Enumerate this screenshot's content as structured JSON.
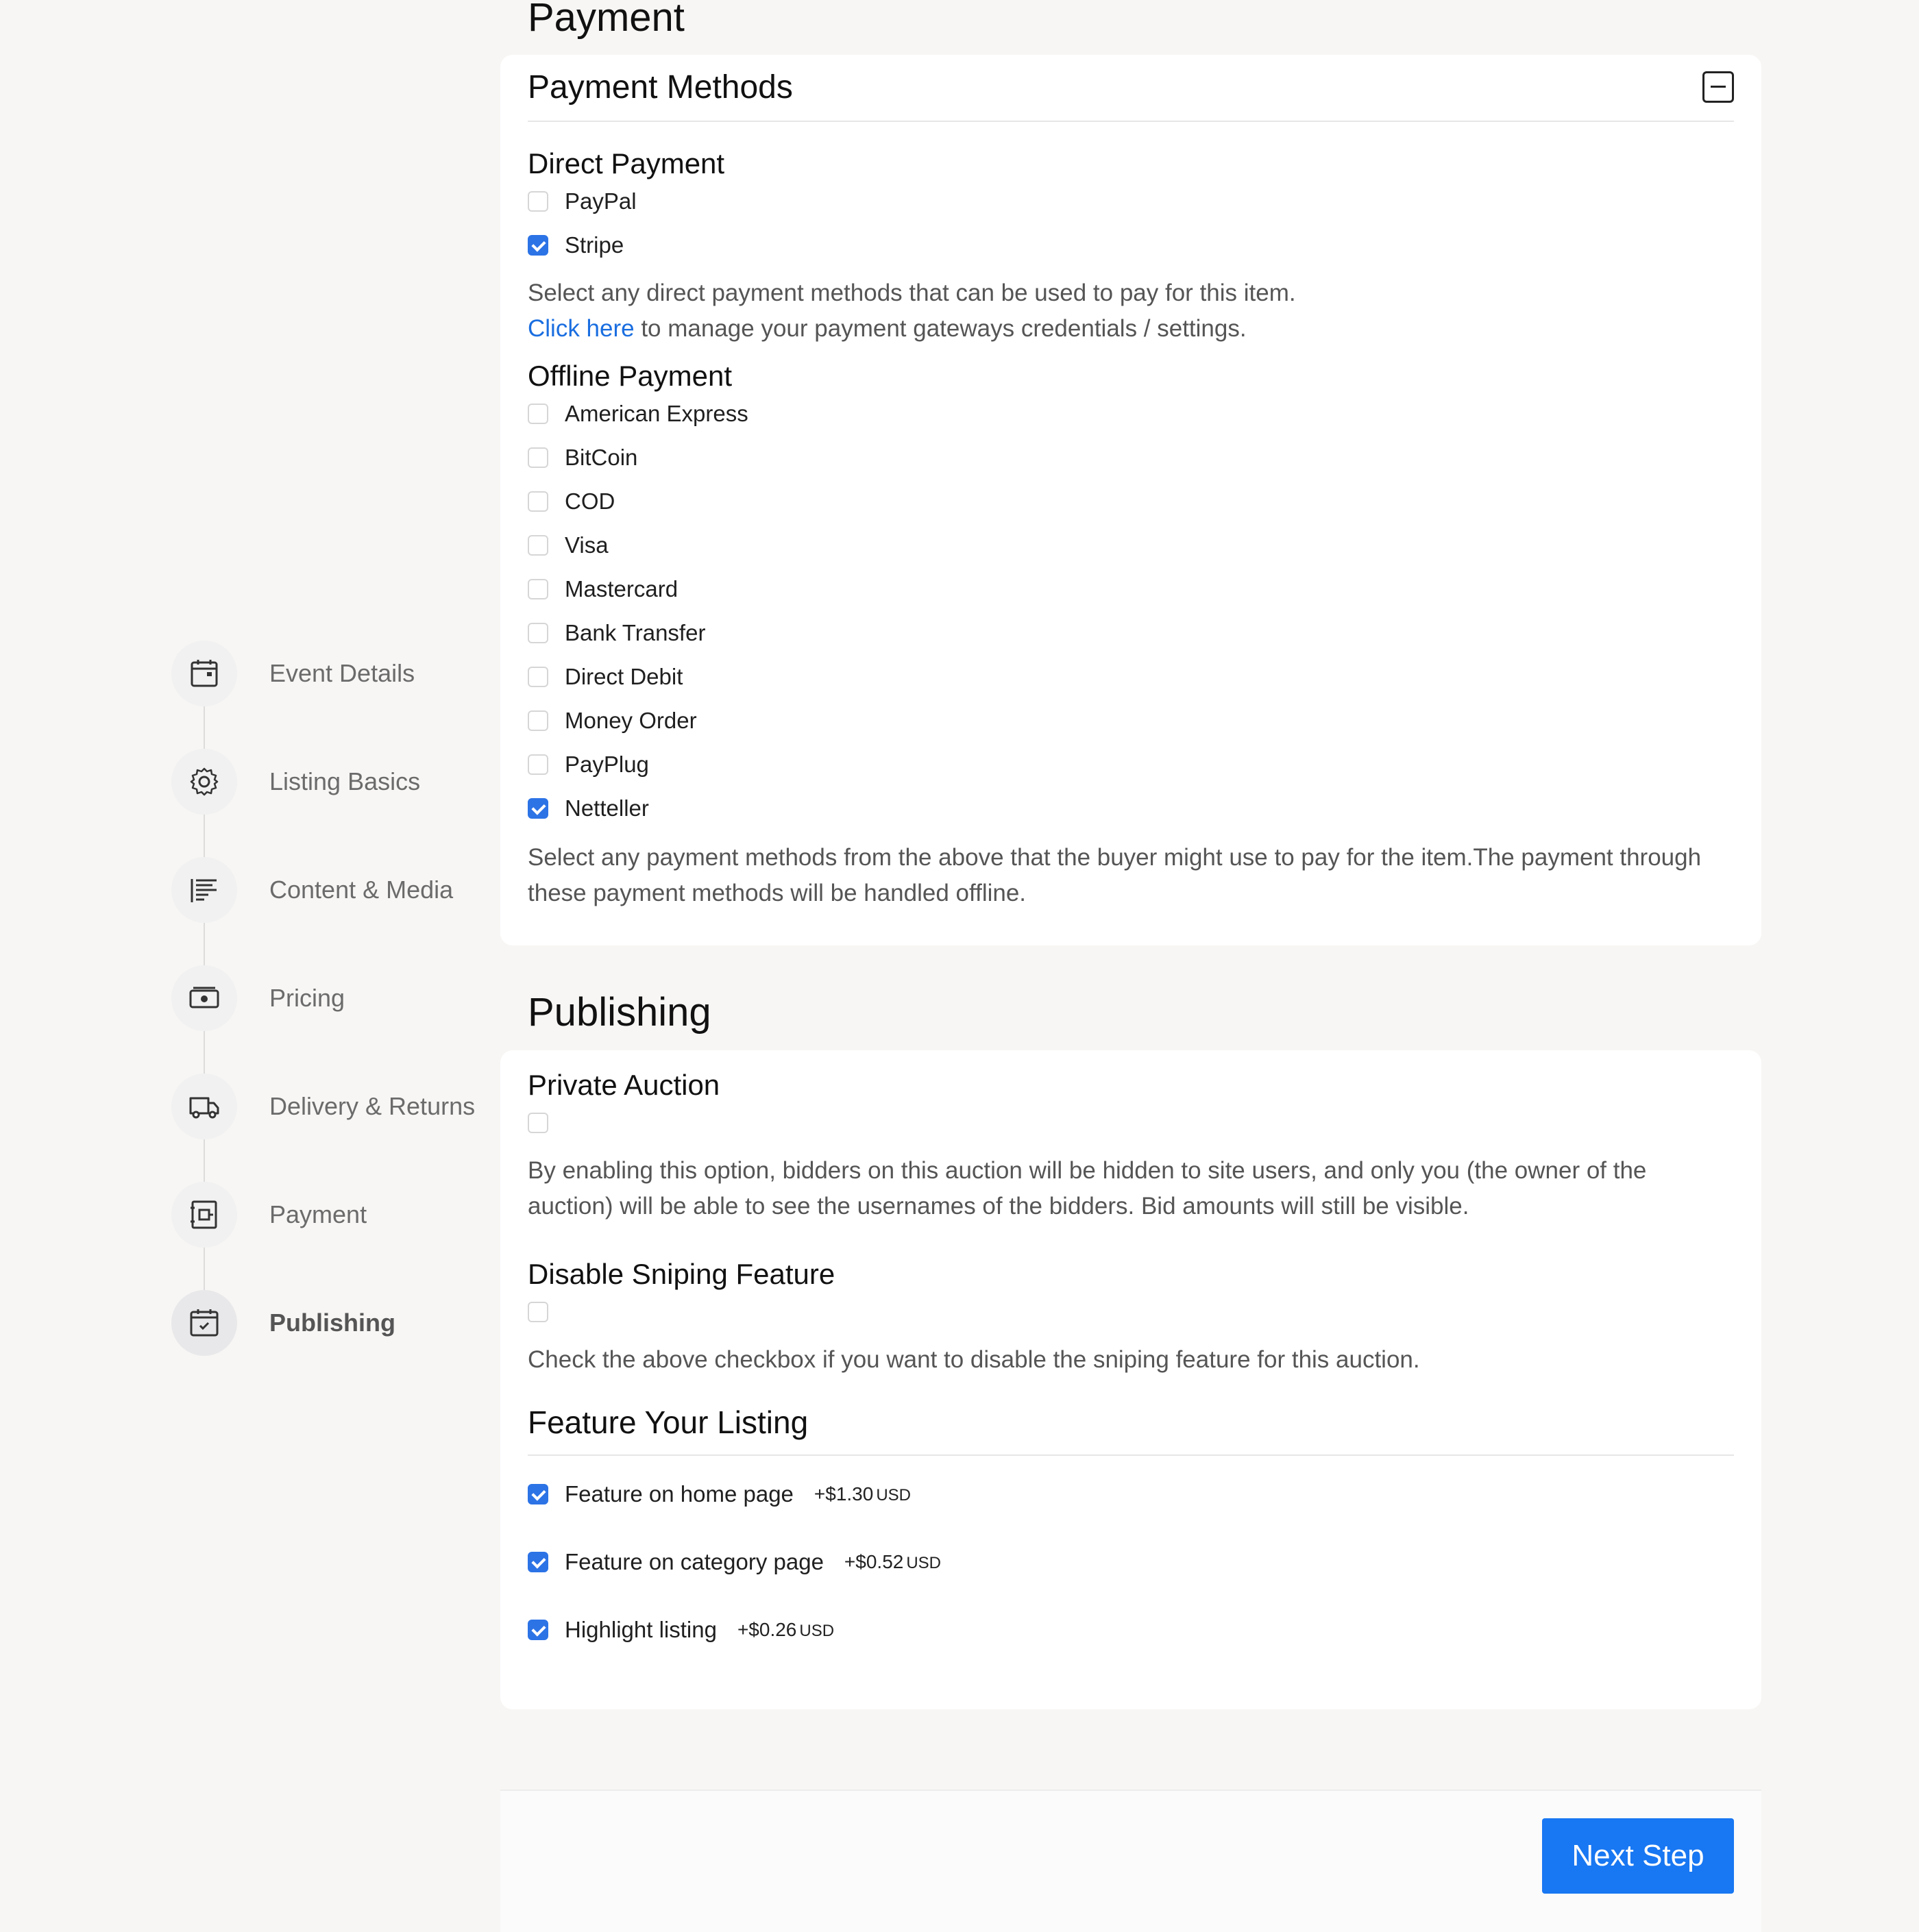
{
  "stepper": {
    "steps": [
      {
        "label": "Event Details",
        "icon": "calendar-icon"
      },
      {
        "label": "Listing Basics",
        "icon": "gear-icon"
      },
      {
        "label": "Content & Media",
        "icon": "content-icon"
      },
      {
        "label": "Pricing",
        "icon": "money-icon"
      },
      {
        "label": "Delivery & Returns",
        "icon": "truck-icon"
      },
      {
        "label": "Payment",
        "icon": "safe-icon"
      },
      {
        "label": "Publishing",
        "icon": "calendar-check-icon"
      }
    ],
    "active_index": 6
  },
  "payment": {
    "title": "Payment",
    "card_title": "Payment Methods",
    "direct": {
      "heading": "Direct Payment",
      "options": [
        {
          "label": "PayPal",
          "checked": false
        },
        {
          "label": "Stripe",
          "checked": true
        }
      ],
      "help": "Select any direct payment methods that can be used to pay for this item.",
      "link_text": "Click here",
      "link_suffix": " to manage your payment gateways credentials / settings."
    },
    "offline": {
      "heading": "Offline Payment",
      "options": [
        {
          "label": "American Express",
          "checked": false
        },
        {
          "label": "BitCoin",
          "checked": false
        },
        {
          "label": "COD",
          "checked": false
        },
        {
          "label": "Visa",
          "checked": false
        },
        {
          "label": "Mastercard",
          "checked": false
        },
        {
          "label": "Bank Transfer",
          "checked": false
        },
        {
          "label": "Direct Debit",
          "checked": false
        },
        {
          "label": "Money Order",
          "checked": false
        },
        {
          "label": "PayPlug",
          "checked": false
        },
        {
          "label": "Netteller",
          "checked": true
        }
      ],
      "help": "Select any payment methods from the above that the buyer might use to pay for the item.The payment through these payment methods will be handled offline."
    }
  },
  "publishing": {
    "title": "Publishing",
    "private_auction": {
      "heading": "Private Auction",
      "checked": false,
      "help": "By enabling this option, bidders on this auction will be hidden to site users, and only you (the owner of the auction) will be able to see the usernames of the bidders. Bid amounts will still be visible."
    },
    "sniping": {
      "heading": "Disable Sniping Feature",
      "checked": false,
      "help": "Check the above checkbox if you want to disable the sniping feature for this auction."
    },
    "feature": {
      "heading": "Feature Your Listing",
      "options": [
        {
          "label": "Feature on home page",
          "price": "+$1.30",
          "currency": "USD",
          "checked": true
        },
        {
          "label": "Feature on category page",
          "price": "+$0.52",
          "currency": "USD",
          "checked": true
        },
        {
          "label": "Highlight listing",
          "price": "+$0.26",
          "currency": "USD",
          "checked": true
        }
      ]
    }
  },
  "footer": {
    "next_label": "Next Step"
  },
  "colors": {
    "accent": "#1877f2",
    "checkbox_checked": "#2c73e6",
    "link": "#1a6ee0",
    "page_bg": "#f7f6f4"
  }
}
